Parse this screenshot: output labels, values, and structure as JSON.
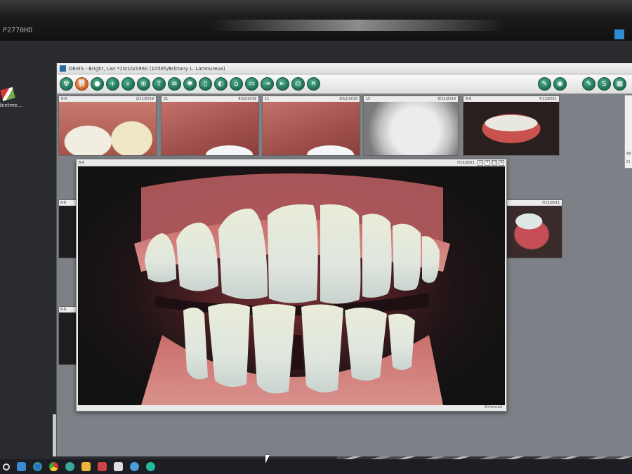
{
  "monitor": {
    "model": "P2770HD"
  },
  "desktop": {
    "shortcut_label": "bintme..."
  },
  "app": {
    "title": "DEXIS - Bright, Lan *10/10/1960 (10585/Brittany L. Lamoureux)",
    "toolbar_left_icons": [
      "radiation-icon",
      "tooth-icon",
      "person-icon",
      "add-icon",
      "zoom-icon",
      "zoom-plus-icon",
      "tools-icon",
      "list-icon",
      "sparkle-icon",
      "compare-icon",
      "image-icon",
      "home-icon",
      "folder-icon",
      "export-icon",
      "import-icon",
      "print-icon",
      "close-icon"
    ],
    "toolbar_right_icons": [
      "pen-icon",
      "camera-icon"
    ],
    "toolbar_right2_icons": [
      "pen2-icon",
      "s-icon",
      "grid-icon",
      "more-icon"
    ]
  },
  "thumbnails": [
    {
      "label": "8-8",
      "date": "2/21/2019"
    },
    {
      "label": "21",
      "date": "8/12/2019"
    },
    {
      "label": "11",
      "date": "8/12/2019"
    },
    {
      "label": "15",
      "date": "8/12/2019"
    },
    {
      "label": "8-8",
      "date": "7/13/2021"
    }
  ],
  "side_thumbnails": [
    {
      "label": "8-8"
    },
    {
      "label": "8-8"
    }
  ],
  "right_thumbnail": {
    "date": "7/13/2021"
  },
  "right_panel": {
    "items": [
      "Ad",
      "Cl"
    ]
  },
  "viewer": {
    "label": "8-8",
    "date": "7/13/2021",
    "footer": "Enhanced"
  },
  "colors": {
    "toolbar_button": "#1f6f55",
    "active_button": "#d2601c",
    "taskbar": "#1c1e24"
  }
}
